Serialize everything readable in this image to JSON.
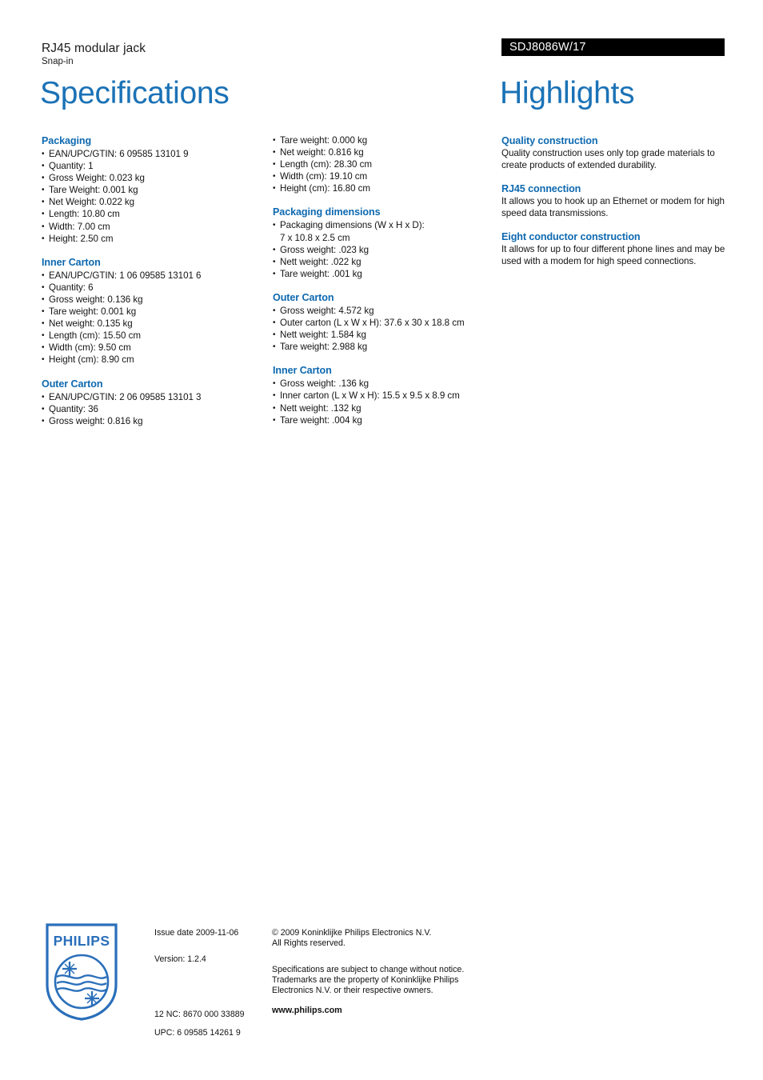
{
  "header": {
    "product_name": "RJ45 modular jack",
    "product_subname": "Snap-in",
    "sku": "SDJ8086W/17",
    "title_left": "Specifications",
    "title_right": "Highlights",
    "accent_blue": "#0e69b0",
    "title_blue": "#1b72b6",
    "sku_bar_color": "#000000"
  },
  "spec_column_1": [
    {
      "title": "Packaging",
      "items": [
        "EAN/UPC/GTIN: 6 09585 13101 9",
        "Quantity: 1",
        "Gross Weight: 0.023 kg",
        "Tare Weight: 0.001 kg",
        "Net Weight: 0.022 kg",
        "Length: 10.80 cm",
        "Width: 7.00 cm",
        "Height: 2.50 cm"
      ]
    },
    {
      "title": "Inner Carton",
      "items": [
        "EAN/UPC/GTIN: 1 06 09585 13101 6",
        "Quantity: 6",
        "Gross weight: 0.136 kg",
        "Tare weight: 0.001 kg",
        "Net weight: 0.135 kg",
        "Length (cm): 15.50 cm",
        "Width (cm): 9.50 cm",
        "Height (cm): 8.90 cm"
      ]
    },
    {
      "title": "Outer Carton",
      "items": [
        "EAN/UPC/GTIN: 2 06 09585 13101 3",
        "Quantity: 36",
        "Gross weight: 0.816 kg"
      ]
    }
  ],
  "spec_column_2": [
    {
      "title": "",
      "items": [
        "Tare weight: 0.000 kg",
        "Net weight: 0.816 kg",
        "Length (cm): 28.30 cm",
        "Width (cm): 19.10 cm",
        "Height (cm): 16.80 cm"
      ]
    },
    {
      "title": "Packaging dimensions",
      "items": [
        "Packaging dimensions (W x H x D):",
        "Gross weight: .023 kg",
        "Nett weight: .022 kg",
        "Tare weight: .001 kg"
      ],
      "continuation_0": "7 x 10.8 x 2.5 cm"
    },
    {
      "title": "Outer Carton",
      "items": [
        "Gross weight: 4.572 kg",
        "Outer carton (L x W x H): 37.6 x 30 x 18.8 cm",
        "Nett weight: 1.584 kg",
        "Tare weight: 2.988 kg"
      ]
    },
    {
      "title": "Inner Carton",
      "items": [
        "Gross weight: .136 kg",
        "Inner carton (L x W x H): 15.5 x 9.5 x 8.9 cm",
        "Nett weight: .132 kg",
        "Tare weight: .004 kg"
      ]
    }
  ],
  "highlights": [
    {
      "title": "Quality construction",
      "body": "Quality construction uses only top grade materials to create products of extended durability."
    },
    {
      "title": "RJ45 connection",
      "body": "It allows you to hook up an Ethernet or modem for high speed data transmissions."
    },
    {
      "title": "Eight conductor construction",
      "body": "It allows for up to four different phone lines and may be used with a modem for high speed connections."
    }
  ],
  "footer": {
    "logo_wordmark": "PHILIPS",
    "issue_date": "Issue date 2009-11-06",
    "version": "Version: 1.2.4",
    "nc_code": "12 NC: 8670 000 33889",
    "upc_code": "UPC: 6 09585 14261 9",
    "copyright_line_1": "© 2009 Koninklijke Philips Electronics N.V.",
    "copyright_line_2": "All Rights reserved.",
    "disclaimer_line_1": "Specifications are subject to change without notice.",
    "disclaimer_line_2": "Trademarks are the property of Koninklijke Philips",
    "disclaimer_line_3": "Electronics N.V. or their respective owners.",
    "website": "www.philips.com",
    "logo_color": "#2a6fba"
  }
}
